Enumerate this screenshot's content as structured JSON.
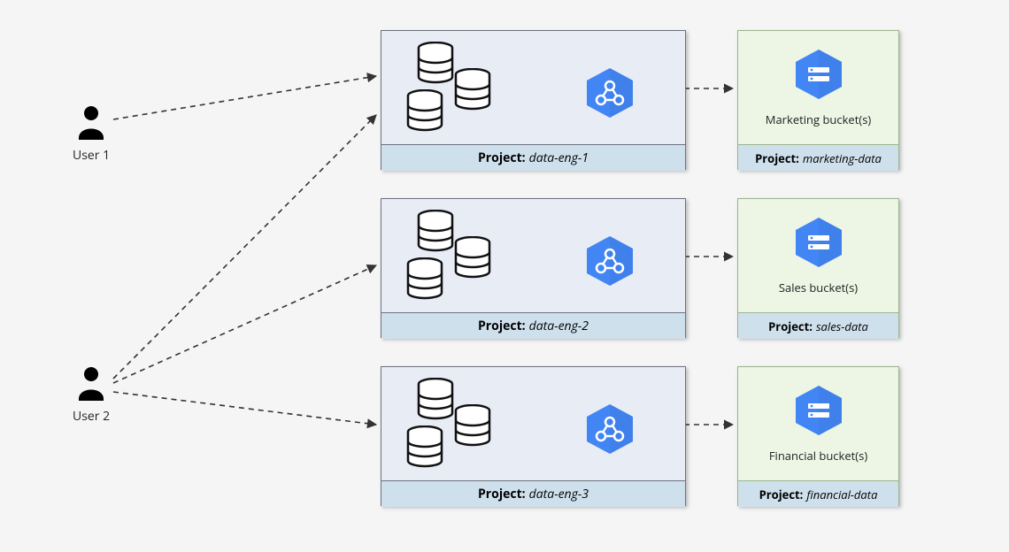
{
  "users": [
    {
      "label": "User 1"
    },
    {
      "label": "User 2"
    }
  ],
  "eng_projects": [
    {
      "footer_bold": "Project:",
      "footer_name": "data-eng-1"
    },
    {
      "footer_bold": "Project:",
      "footer_name": "data-eng-2"
    },
    {
      "footer_bold": "Project:",
      "footer_name": "data-eng-3"
    }
  ],
  "bucket_projects": [
    {
      "bucket_label": "Marketing bucket(s)",
      "footer_bold": "Project:",
      "footer_name": "marketing-data"
    },
    {
      "bucket_label": "Sales bucket(s)",
      "footer_bold": "Project:",
      "footer_name": "sales-data"
    },
    {
      "bucket_label": "Financial bucket(s)",
      "footer_bold": "Project:",
      "footer_name": "financial-data"
    }
  ],
  "colors": {
    "accent": "#4285f4",
    "eng_bg": "#e8ecf5",
    "bucket_bg": "#edf5e5",
    "footer_bg": "#cfe0ed"
  }
}
